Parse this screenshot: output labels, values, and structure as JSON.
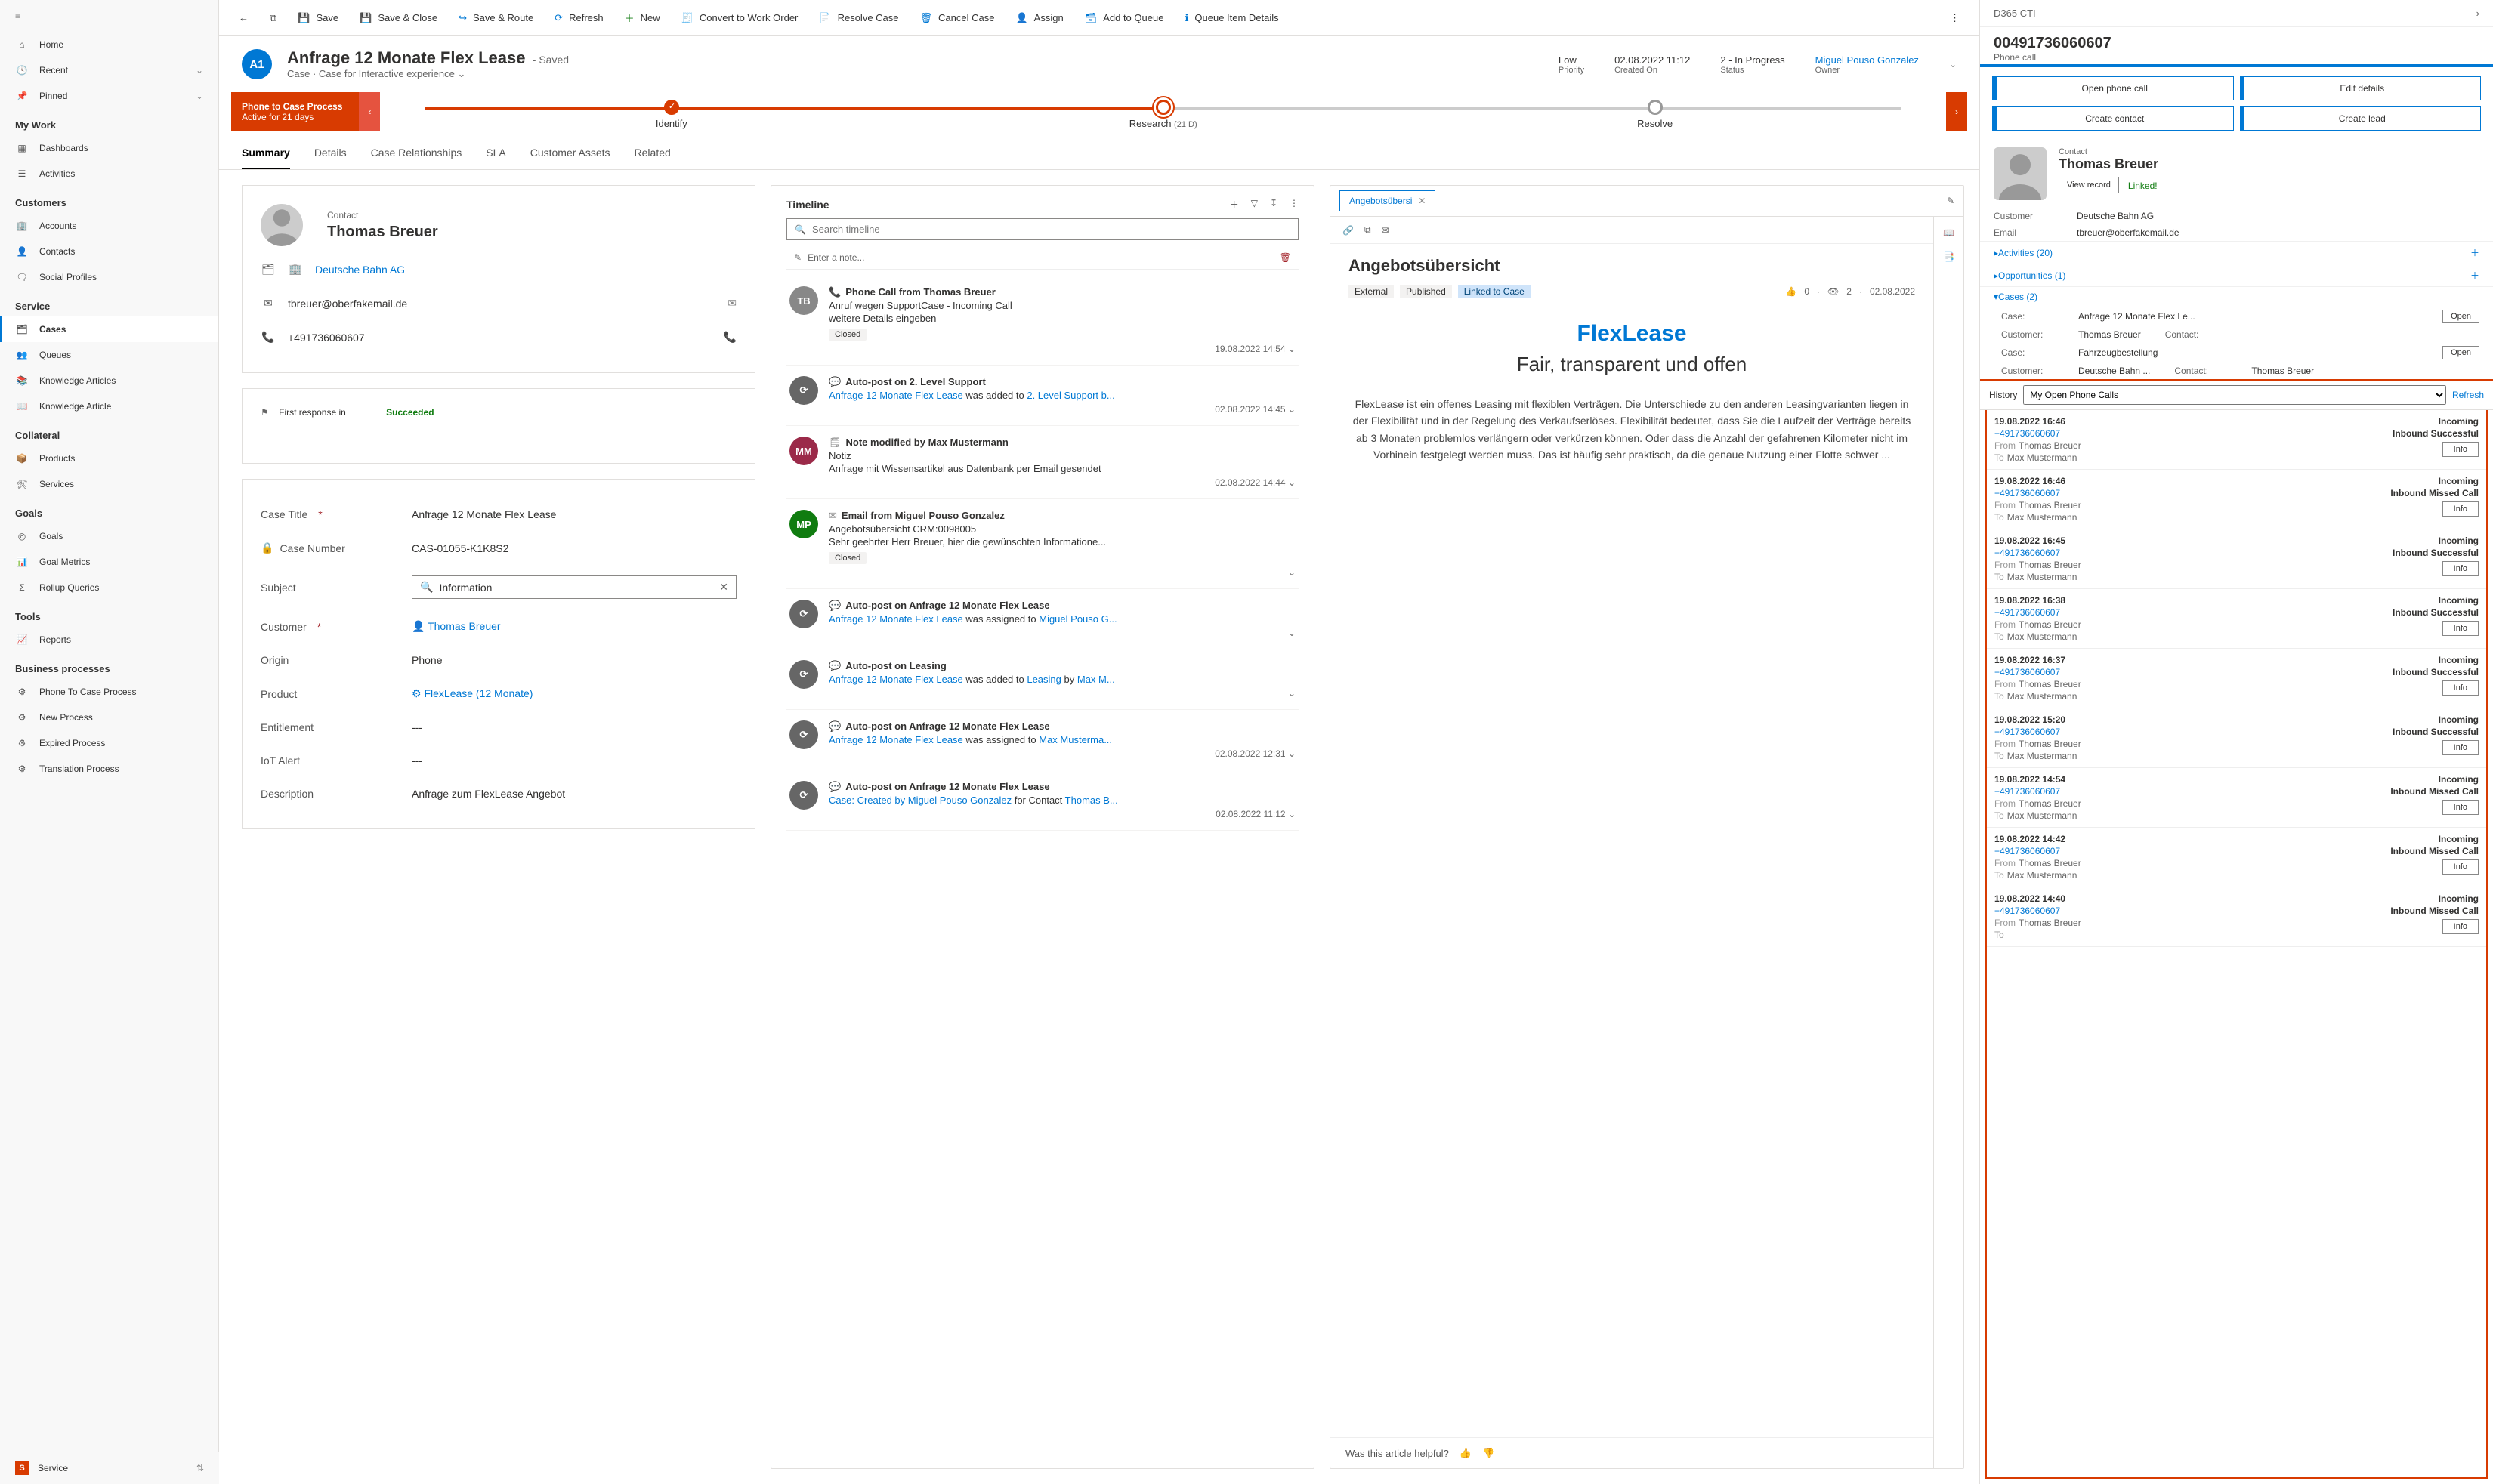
{
  "nav": {
    "home": "Home",
    "recent": "Recent",
    "pinned": "Pinned",
    "groups": {
      "mywork": "My Work",
      "customers": "Customers",
      "service": "Service",
      "collateral": "Collateral",
      "goals": "Goals",
      "tools": "Tools",
      "bp": "Business processes"
    },
    "items": {
      "dashboards": "Dashboards",
      "activities": "Activities",
      "accounts": "Accounts",
      "contacts": "Contacts",
      "social": "Social Profiles",
      "cases": "Cases",
      "queues": "Queues",
      "karticles": "Knowledge Articles",
      "karticle": "Knowledge Article",
      "products": "Products",
      "services": "Services",
      "goals": "Goals",
      "goalmetrics": "Goal Metrics",
      "rollup": "Rollup Queries",
      "reports": "Reports",
      "ptcp": "Phone To Case Process",
      "newproc": "New Process",
      "expproc": "Expired Process",
      "transproc": "Translation Process"
    },
    "area": "Service"
  },
  "cmd": {
    "save": "Save",
    "saveclose": "Save & Close",
    "saveroute": "Save & Route",
    "refresh": "Refresh",
    "new": "New",
    "convertwo": "Convert to Work Order",
    "resolve": "Resolve Case",
    "cancel": "Cancel Case",
    "assign": "Assign",
    "addqueue": "Add to Queue",
    "queueitem": "Queue Item Details"
  },
  "record": {
    "badge": "A1",
    "title": "Anfrage 12 Monate Flex Lease",
    "saved": "- Saved",
    "subtitle": "Case · Case for Interactive experience",
    "priority": {
      "val": "Low",
      "lbl": "Priority"
    },
    "createdon": {
      "val": "02.08.2022 11:12",
      "lbl": "Created On"
    },
    "status": {
      "val": "2 - In Progress",
      "lbl": "Status"
    },
    "owner": {
      "val": "Miguel Pouso Gonzalez",
      "lbl": "Owner"
    }
  },
  "bpf": {
    "name": "Phone to Case Process",
    "duration": "Active for 21 days",
    "stages": [
      {
        "lbl": "Identify"
      },
      {
        "lbl": "Research",
        "sub": "(21 D)"
      },
      {
        "lbl": "Resolve"
      }
    ]
  },
  "tabs": [
    "Summary",
    "Details",
    "Case Relationships",
    "SLA",
    "Customer Assets",
    "Related"
  ],
  "contact": {
    "label": "Contact",
    "name": "Thomas Breuer",
    "company": "Deutsche Bahn AG",
    "email": "tbreuer@oberfakemail.de",
    "phone": "+491736060607"
  },
  "sla": {
    "label": "First response in",
    "value": "Succeeded"
  },
  "form": {
    "casetitle": {
      "lbl": "Case Title",
      "val": "Anfrage 12 Monate Flex Lease"
    },
    "casenumber": {
      "lbl": "Case Number",
      "val": "CAS-01055-K1K8S2"
    },
    "subject": {
      "lbl": "Subject",
      "val": "Information"
    },
    "customer": {
      "lbl": "Customer",
      "val": "Thomas Breuer"
    },
    "origin": {
      "lbl": "Origin",
      "val": "Phone"
    },
    "product": {
      "lbl": "Product",
      "val": "FlexLease (12 Monate)"
    },
    "entitlement": {
      "lbl": "Entitlement",
      "val": "---"
    },
    "iotalert": {
      "lbl": "IoT Alert",
      "val": "---"
    },
    "description": {
      "lbl": "Description",
      "val": "Anfrage zum FlexLease Angebot"
    }
  },
  "timeline": {
    "title": "Timeline",
    "search_ph": "Search timeline",
    "note_ph": "Enter a note...",
    "items": [
      {
        "avatar": "TB",
        "avclass": "",
        "icon": "📞",
        "title": "Phone Call from Thomas Breuer",
        "line1": "Anruf wegen SupportCase - Incoming Call",
        "line2": "weitere Details eingeben",
        "pill": "Closed",
        "ts": "19.08.2022 14:54"
      },
      {
        "avatar": "⟳",
        "avclass": "sys",
        "icon": "💬",
        "title": "Auto-post on 2. Level Support",
        "line1_a": "Anfrage 12 Monate Flex Lease",
        "line1_b": " was added to ",
        "line1_c": "2. Level Support b...",
        "ts": "02.08.2022 14:45"
      },
      {
        "avatar": "MM",
        "avclass": "mm",
        "icon": "🗒",
        "title": "Note modified by Max Mustermann",
        "line1": "Notiz",
        "line2": "Anfrage mit Wissensartikel aus Datenbank per Email gesendet",
        "ts": "02.08.2022 14:44"
      },
      {
        "avatar": "MP",
        "avclass": "mp",
        "icon": "✉",
        "title": "Email from Miguel Pouso Gonzalez",
        "line1": "Angebotsübersicht CRM:0098005",
        "line2": "Sehr geehrter Herr Breuer,  hier die gewünschten Informatione...",
        "pill": "Closed",
        "ts": ""
      },
      {
        "avatar": "⟳",
        "avclass": "sys",
        "icon": "💬",
        "title": "Auto-post on Anfrage 12 Monate Flex Lease",
        "line1_a": "Anfrage 12 Monate Flex Lease",
        "line1_b": " was assigned to ",
        "line1_c": "Miguel Pouso G...",
        "ts": ""
      },
      {
        "avatar": "⟳",
        "avclass": "sys",
        "icon": "💬",
        "title": "Auto-post on Leasing",
        "line1_a": "Anfrage 12 Monate Flex Lease",
        "line1_b": " was added to ",
        "line1_c": "Leasing",
        "line1_d": " by ",
        "line1_e": "Max M...",
        "ts": ""
      },
      {
        "avatar": "⟳",
        "avclass": "sys",
        "icon": "💬",
        "title": "Auto-post on Anfrage 12 Monate Flex Lease",
        "line1_a": "Anfrage 12 Monate Flex Lease",
        "line1_b": " was assigned to ",
        "line1_c": "Max Musterma...",
        "ts": "02.08.2022 12:31"
      },
      {
        "avatar": "⟳",
        "avclass": "sys",
        "icon": "💬",
        "title": "Auto-post on Anfrage 12 Monate Flex Lease",
        "line1_a": "Case: Created by ",
        "line1_c": "Miguel Pouso Gonzalez",
        "line1_d": " for Contact ",
        "line1_e": "Thomas B...",
        "ts": "02.08.2022 11:12"
      }
    ]
  },
  "kb": {
    "tab": "Angebotsübersi",
    "title": "Angebotsübersicht",
    "badges": {
      "external": "External",
      "published": "Published",
      "linked": "Linked to Case"
    },
    "meta": {
      "likes": "0",
      "views": "2",
      "date": "02.08.2022"
    },
    "hero": "FlexLease",
    "sub": "Fair, transparent und offen",
    "body": "FlexLease ist ein offenes Leasing mit flexiblen Verträgen. Die Unterschiede zu den anderen Leasingvarianten liegen in der Flexibilität und in der Regelung des Verkaufserlöses. Flexibilität bedeutet, dass Sie die Laufzeit der Verträge bereits ab 3 Monaten problemlos verlängern oder verkürzen können. Oder dass die Anzahl der gefahrenen Kilometer nicht im Vorhinein festgelegt werden muss. Das ist häufig sehr praktisch, da die genaue Nutzung einer Flotte schwer ...",
    "helpful": "Was this article helpful?"
  },
  "cti": {
    "header": "D365 CTI",
    "number": "00491736060607",
    "type": "Phone call",
    "buttons": {
      "openpc": "Open phone call",
      "editdet": "Edit details",
      "createcontact": "Create contact",
      "createlead": "Create lead"
    },
    "contact": {
      "label": "Contact",
      "name": "Thomas Breuer",
      "view": "View record",
      "linked": "Linked!",
      "customer_lbl": "Customer",
      "customer": "Deutsche Bahn AG",
      "email_lbl": "Email",
      "email": "tbreuer@oberfakemail.de"
    },
    "sections": {
      "activities": "Activities (20)",
      "opportunities": "Opportunities (1)",
      "cases": "Cases (2)"
    },
    "cases": [
      {
        "case_lbl": "Case:",
        "case": "Anfrage 12 Monate Flex Le...",
        "open": "Open",
        "cust_lbl": "Customer:",
        "cust": "Thomas Breuer",
        "contact_lbl": "Contact:"
      },
      {
        "case_lbl": "Case:",
        "case": "Fahrzeugbestellung",
        "open": "Open",
        "cust_lbl": "Customer:",
        "cust": "Deutsche Bahn ...",
        "contact_lbl": "Contact:",
        "contact": "Thomas Breuer"
      }
    ],
    "history": {
      "label": "History",
      "filter": "My Open Phone Calls",
      "refresh": "Refresh",
      "items": [
        {
          "dt": "19.08.2022 16:46",
          "dir": "Incoming",
          "num": "+491736060607",
          "res": "Inbound Successful",
          "from": "Thomas Breuer",
          "to": "Max Mustermann"
        },
        {
          "dt": "19.08.2022 16:46",
          "dir": "Incoming",
          "num": "+491736060607",
          "res": "Inbound Missed Call",
          "from": "Thomas Breuer",
          "to": "Max Mustermann"
        },
        {
          "dt": "19.08.2022 16:45",
          "dir": "Incoming",
          "num": "+491736060607",
          "res": "Inbound Successful",
          "from": "Thomas Breuer",
          "to": "Max Mustermann"
        },
        {
          "dt": "19.08.2022 16:38",
          "dir": "Incoming",
          "num": "+491736060607",
          "res": "Inbound Successful",
          "from": "Thomas Breuer",
          "to": "Max Mustermann"
        },
        {
          "dt": "19.08.2022 16:37",
          "dir": "Incoming",
          "num": "+491736060607",
          "res": "Inbound Successful",
          "from": "Thomas Breuer",
          "to": "Max Mustermann"
        },
        {
          "dt": "19.08.2022 15:20",
          "dir": "Incoming",
          "num": "+491736060607",
          "res": "Inbound Successful",
          "from": "Thomas Breuer",
          "to": "Max Mustermann"
        },
        {
          "dt": "19.08.2022 14:54",
          "dir": "Incoming",
          "num": "+491736060607",
          "res": "Inbound Missed Call",
          "from": "Thomas Breuer",
          "to": "Max Mustermann"
        },
        {
          "dt": "19.08.2022 14:42",
          "dir": "Incoming",
          "num": "+491736060607",
          "res": "Inbound Missed Call",
          "from": "Thomas Breuer",
          "to": "Max Mustermann"
        },
        {
          "dt": "19.08.2022 14:40",
          "dir": "Incoming",
          "num": "+491736060607",
          "res": "Inbound Missed Call",
          "from": "Thomas Breuer",
          "to": ""
        }
      ],
      "info": "Info",
      "from_lbl": "From",
      "to_lbl": "To"
    }
  }
}
